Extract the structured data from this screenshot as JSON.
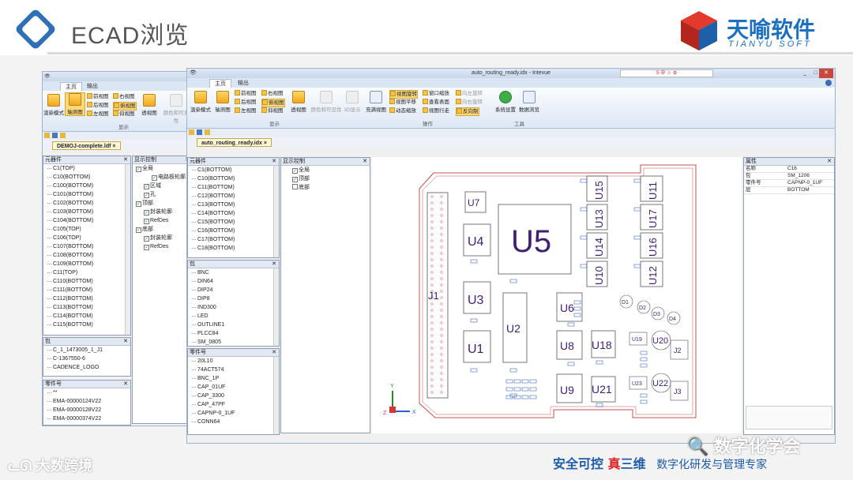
{
  "slide": {
    "title": "ECAD浏览",
    "brand_name": "天喻软件",
    "brand_en": "TIANYU SOFT",
    "slogan_part1": "安全可控 ",
    "slogan_red": "真",
    "slogan_part2": "三维",
    "slogan_sub": "数字化研发与管理专家",
    "watermark_left": "大数跨境",
    "watermark_right": "数字化学会"
  },
  "back_window": {
    "tabs": [
      "主页",
      "输出"
    ],
    "ribbon": {
      "render_mode": "渲染模式",
      "axis_view": "轴测图",
      "front": "前视图",
      "right": "右视图",
      "back": "后视图",
      "top": "俯视图",
      "left": "左视图",
      "bottom": "仰视图",
      "perspective": "透视图",
      "color_visibility": "颜色和可见性",
      "group": "显示"
    },
    "doc_tab": "DEMOJ-complete.ldf",
    "components_title": "元器件",
    "components": [
      "C1(TOP)",
      "C10(BOTTOM)",
      "C100(BOTTOM)",
      "C101(BOTTOM)",
      "C102(BOTTOM)",
      "C103(BOTTOM)",
      "C104(BOTTOM)",
      "C105(TOP)",
      "C106(TOP)",
      "C107(BOTTOM)",
      "C108(BOTTOM)",
      "C109(BOTTOM)",
      "C11(TOP)",
      "C110(BOTTOM)",
      "C111(BOTTOM)",
      "C112(BOTTOM)",
      "C113(BOTTOM)",
      "C114(BOTTOM)",
      "C115(BOTTOM)"
    ],
    "display_title": "显示控制",
    "display_tree": [
      "全局",
      "电路板轮廓",
      "区域",
      "孔",
      "顶部",
      "封装轮廓",
      "RefDes",
      "底部",
      "封装轮廓",
      "RefDes"
    ],
    "package_title": "包",
    "packages": [
      "C_1_1473005_1_J1",
      "C-1367550-6",
      "CADENCE_LOGO"
    ],
    "part_title": "零件号",
    "parts": [
      "**",
      "EMA-00000124V22",
      "EMA-00000128V22",
      "EMA-00000374V22"
    ]
  },
  "front_window": {
    "title": "auto_routing_ready.idx - Intevue",
    "tabs": [
      "主页",
      "输出"
    ],
    "ribbon": {
      "render_mode": "渲染模式",
      "axis_view": "轴测图",
      "front": "前视图",
      "right": "右视图",
      "back": "后视图",
      "top": "俯视图",
      "left": "左视图",
      "bottom": "仰视图",
      "perspective": "透视图",
      "color_visibility": "颜色和可见性",
      "show3d": "3D显示",
      "group_display": "显示",
      "fill_view": "充满视图",
      "view_rotate": "视图旋转",
      "window_zoom": "窗口缩放",
      "rotate_left": "向左旋转",
      "view_pan": "视图平移",
      "view_surface": "查看表面",
      "rotate_right": "向右旋转",
      "dynamic_zoom": "动态缩放",
      "view_walk": "视图行走",
      "reverse": "反向制",
      "group_operate": "操作",
      "system_settings": "系统设置",
      "data_browse": "数据浏览",
      "group_tools": "工具"
    },
    "doc_tab": "auto_routing_ready.idx",
    "components_title": "元器件",
    "components": [
      "C1(BOTTOM)",
      "C10(BOTTOM)",
      "C11(BOTTOM)",
      "C12(BOTTOM)",
      "C13(BOTTOM)",
      "C14(BOTTOM)",
      "C15(BOTTOM)",
      "C16(BOTTOM)",
      "C17(BOTTOM)",
      "C18(BOTTOM)"
    ],
    "display_title": "显示控制",
    "display_tree": [
      "全局",
      "顶部",
      "底部"
    ],
    "package_title": "包",
    "packages": [
      "BNC",
      "DIN64",
      "DIP24",
      "DIP8",
      "IND300",
      "LED",
      "OUTLINE1",
      "PLCC84",
      "SM_0805"
    ],
    "part_title": "零件号",
    "parts": [
      "",
      "20L10",
      "74ACT574",
      "BNC_1P",
      "CAP_01UF",
      "CAP_3300",
      "CAP_47PF",
      "CAPNP-0_1UF",
      "CONN64"
    ],
    "props_title": "属性",
    "props": [
      {
        "k": "名称",
        "v": "C16"
      },
      {
        "k": "包",
        "v": "SM_1206"
      },
      {
        "k": "零件号",
        "v": "CAPNP-0_1UF"
      },
      {
        "k": "层",
        "v": "BOTTOM"
      }
    ]
  },
  "pcb": {
    "labels": [
      "U5",
      "U4",
      "U3",
      "U1",
      "U7",
      "U2",
      "U6",
      "U8",
      "U9",
      "U18",
      "U21",
      "U15",
      "U13",
      "U14",
      "U10",
      "U11",
      "U17",
      "U16",
      "U12",
      "J1",
      "U20",
      "U22",
      "J2",
      "J3",
      "U19",
      "U23",
      "D1",
      "D2",
      "D3",
      "D4"
    ],
    "axis_y": "Y",
    "axis_x": "X",
    "axis_z": "Z"
  },
  "colors": {
    "accent": "#1d6fbf",
    "pcb_outline": "#c0504d",
    "label": "#3f1f6e"
  }
}
